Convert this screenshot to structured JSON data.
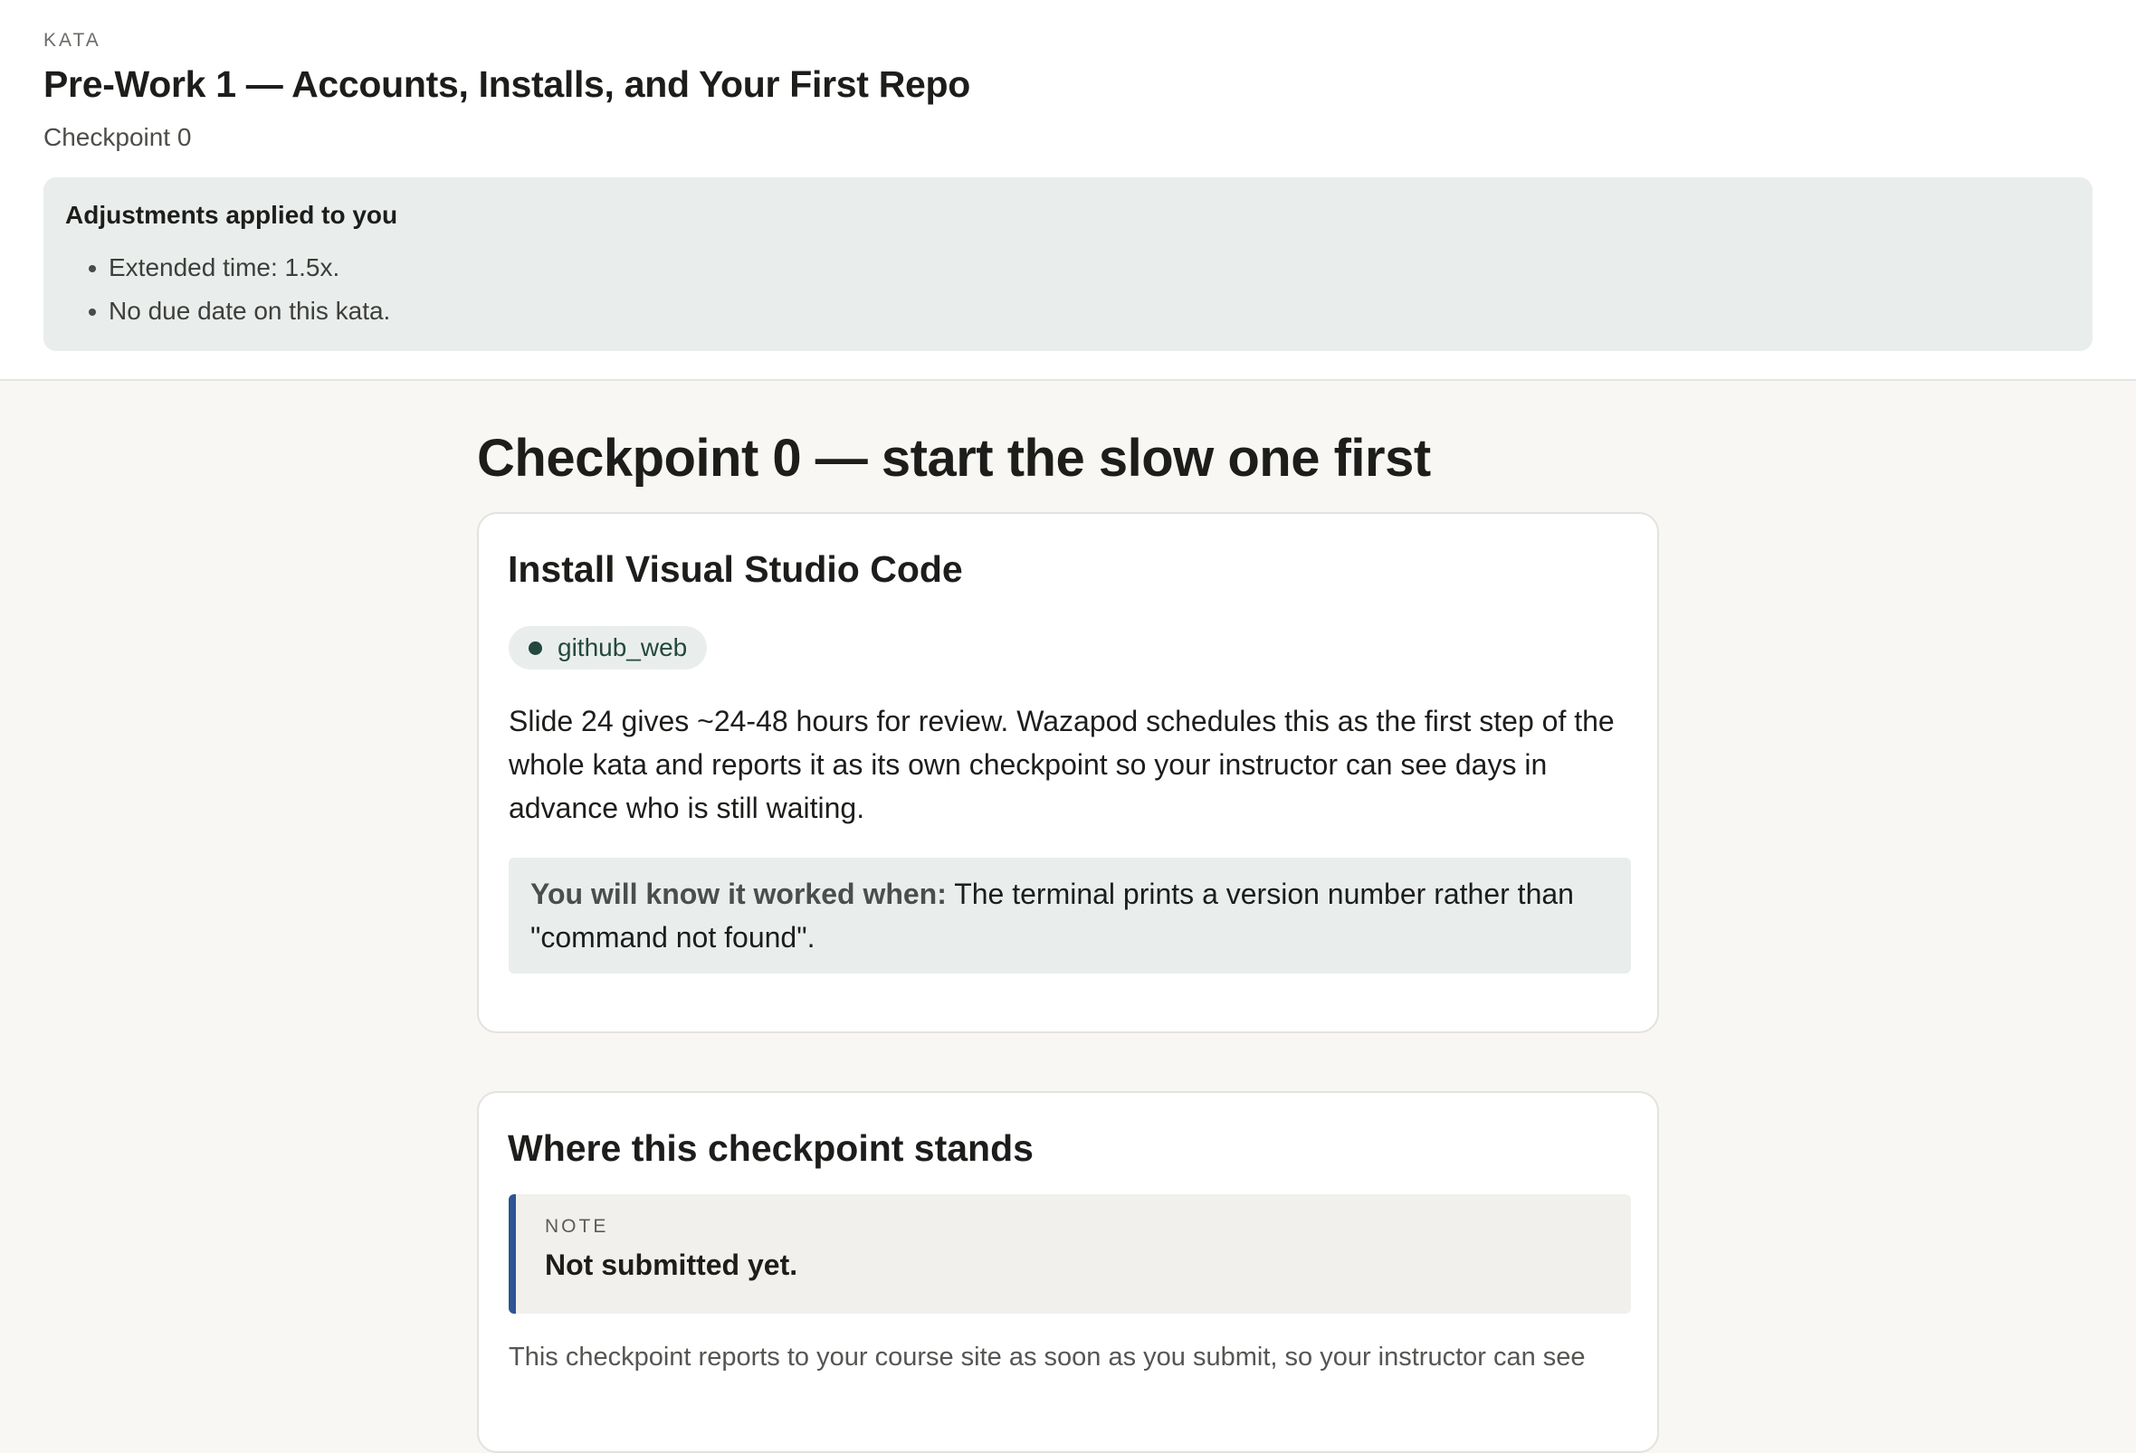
{
  "header": {
    "eyebrow": "KATA",
    "title": "Pre-Work 1 — Accounts, Installs, and Your First Repo",
    "subtitle": "Checkpoint 0"
  },
  "adjustments": {
    "title": "Adjustments applied to you",
    "items": [
      "Extended time: 1.5x.",
      "No due date on this kata."
    ]
  },
  "section": {
    "heading": "Checkpoint 0 — start the slow one first"
  },
  "install_card": {
    "title": "Install Visual Studio Code",
    "tag": "github_web",
    "body": "Slide 24 gives ~24-48 hours for review. Wazapod schedules this as the first step of the whole kata and reports it as its own checkpoint so your instructor can see days in advance who is still waiting.",
    "worked_label": "You will know it worked when:",
    "worked_text": " The terminal prints a version number rather than \"command not found\"."
  },
  "status_card": {
    "title": "Where this checkpoint stands",
    "note_label": "NOTE",
    "note_text": "Not submitted yet.",
    "body": "This checkpoint reports to your course site as soon as you submit, so your instructor can see"
  },
  "colors": {
    "accent_blue": "#2e5593",
    "tag_green": "#24483d",
    "panel_bg": "#e9eeec"
  }
}
